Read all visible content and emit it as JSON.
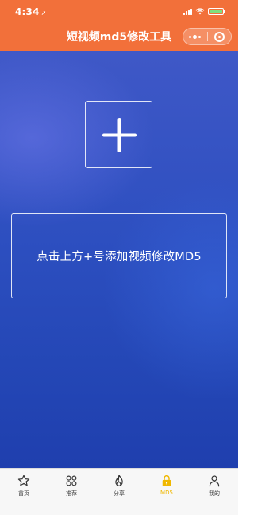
{
  "status_bar": {
    "time": "4:34",
    "location_glyph": "➚",
    "signal_icon": "signal-icon",
    "wifi_icon": "wifi-icon",
    "battery_icon": "battery-icon",
    "battery_status": "charging"
  },
  "header": {
    "title": "短视频md5修改工具",
    "background_color": "#f2703a",
    "capsule": {
      "more_icon": "more-dots-icon",
      "close_icon": "target-close-icon"
    }
  },
  "main": {
    "add_button_icon": "plus-icon",
    "hint_text": "点击上方+号添加视频修改MD5",
    "background_color": "#2d4fc0"
  },
  "tabbar": {
    "active_color": "#f0b800",
    "items": [
      {
        "label": "首页",
        "icon": "star-icon",
        "active": false
      },
      {
        "label": "推荐",
        "icon": "grid-icon",
        "active": false
      },
      {
        "label": "分享",
        "icon": "flame-icon",
        "active": false
      },
      {
        "label": "MD5",
        "icon": "lock-icon",
        "active": true
      },
      {
        "label": "我的",
        "icon": "user-icon",
        "active": false
      }
    ]
  }
}
